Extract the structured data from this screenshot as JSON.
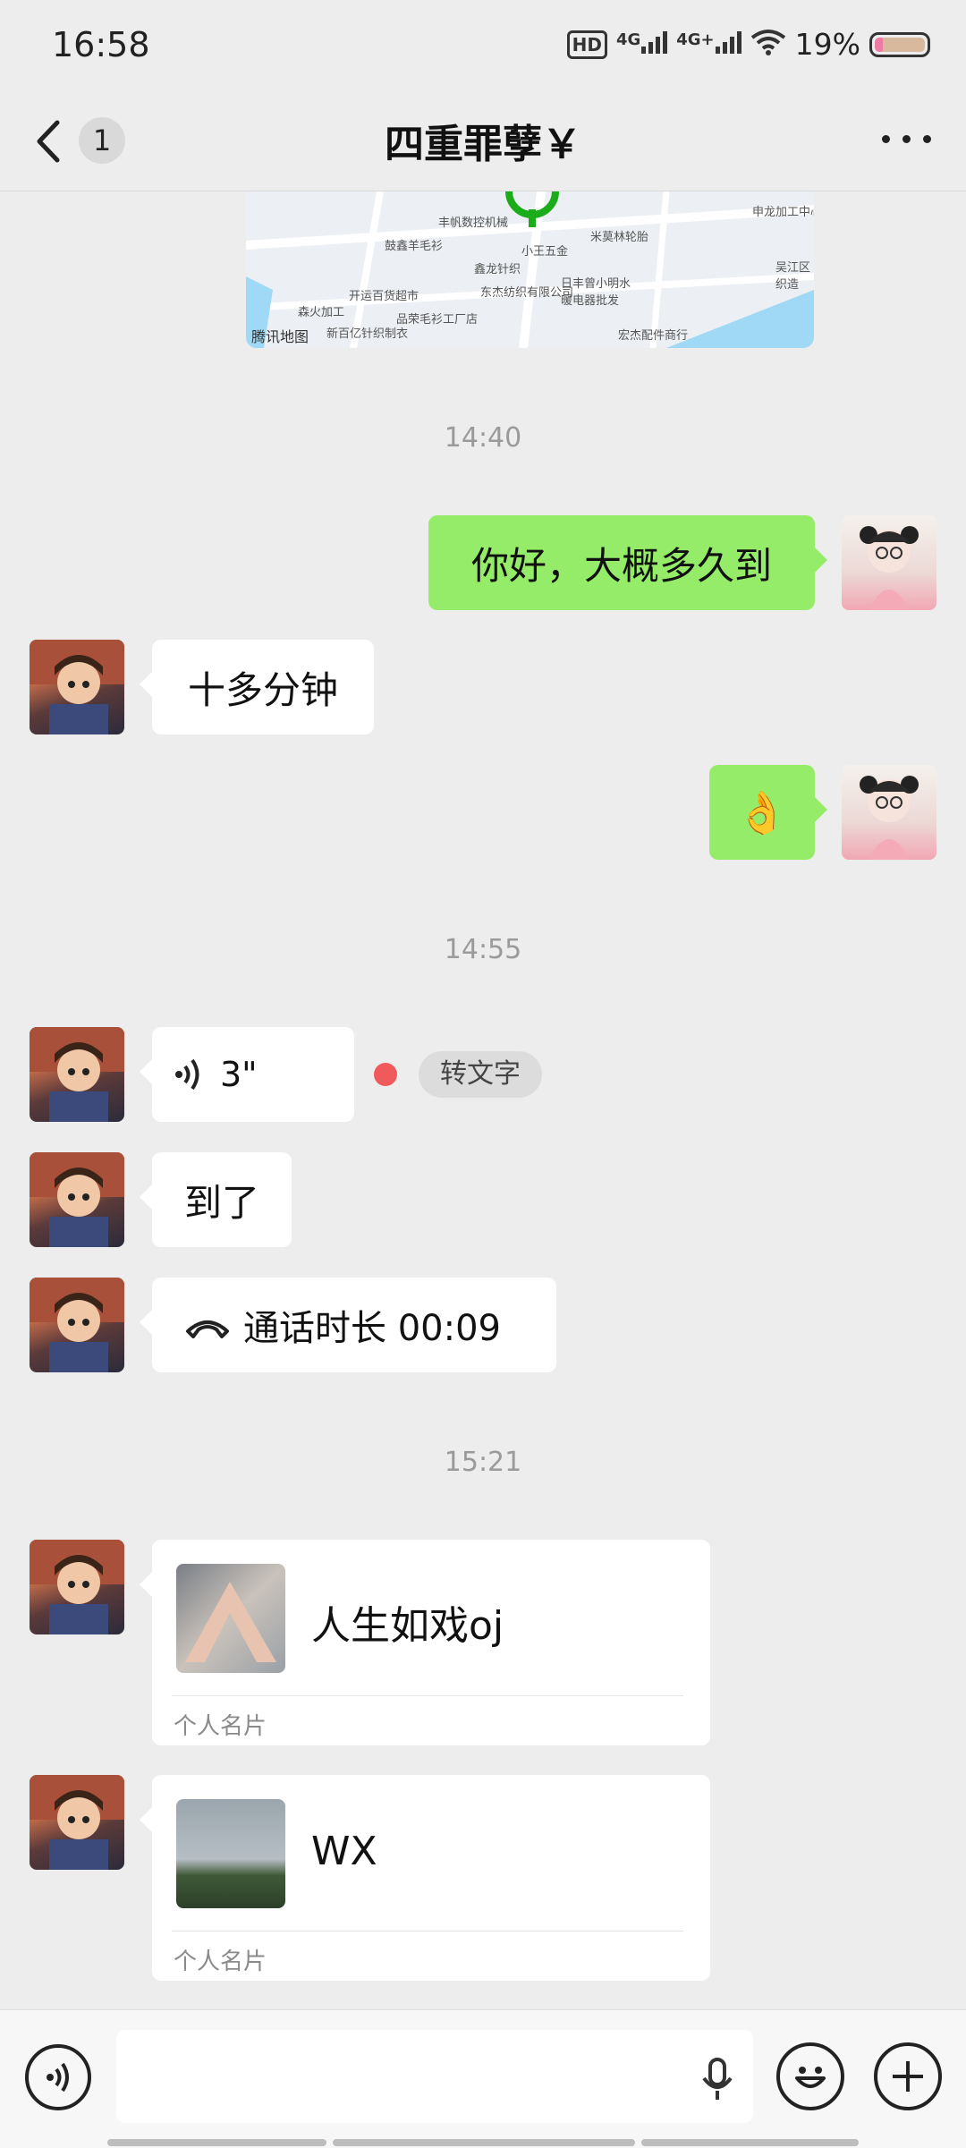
{
  "status_bar": {
    "time": "16:58",
    "hd_label": "HD",
    "net1": "4G",
    "net2": "4G+",
    "battery_text": "19%",
    "battery_level": 0.19,
    "icons": [
      "hd-voice-icon",
      "signal-4g-icon",
      "signal-4g-plus-icon",
      "wifi-icon",
      "battery-icon"
    ]
  },
  "header": {
    "back_icon": "chevron-left-icon",
    "unread_count": "1",
    "title": "四重罪孽￥",
    "more_icon": "more-dots-icon"
  },
  "map_preview": {
    "brand": "腾讯地图",
    "labels": [
      "丰帆数控机械",
      "小王五金",
      "米莫林轮胎",
      "鼓鑫羊毛衫",
      "鑫龙针织",
      "开运百货超市",
      "东杰纺织有限公司",
      "日丰曾小明水暖电器批发",
      "森火加工",
      "品荣毛衫工厂店",
      "新百亿针织制衣",
      "宏杰配件商行",
      "申龙加工中心",
      "吴江区织造"
    ]
  },
  "messages": [
    {
      "type": "timestamp",
      "text": "14:40"
    },
    {
      "type": "text",
      "side": "right",
      "text": "你好，大概多久到"
    },
    {
      "type": "text",
      "side": "left",
      "text": "十多分钟"
    },
    {
      "type": "emoji",
      "side": "right",
      "text": "👌"
    },
    {
      "type": "timestamp",
      "text": "14:55"
    },
    {
      "type": "voice",
      "side": "left",
      "duration": "3\"",
      "unread_dot": true,
      "action_label": "转文字"
    },
    {
      "type": "text",
      "side": "left",
      "text": "到了"
    },
    {
      "type": "call",
      "side": "left",
      "text": "通话时长 00:09"
    },
    {
      "type": "timestamp",
      "text": "15:21"
    },
    {
      "type": "card",
      "side": "left",
      "name": "人生如戏oj",
      "card_type": "个人名片"
    },
    {
      "type": "card",
      "side": "left",
      "name": "WX",
      "card_type": "个人名片"
    }
  ],
  "input_bar": {
    "voice_toggle_icon": "voice-mode-icon",
    "mic_icon": "microphone-icon",
    "emoji_icon": "emoji-smile-icon",
    "plus_icon": "plus-icon",
    "value": ""
  },
  "colors": {
    "background": "#ededed",
    "bubble_self": "#95ec69",
    "bubble_other": "#ffffff",
    "unread_dot": "#f15a5a",
    "map_pin": "#1aad19"
  }
}
